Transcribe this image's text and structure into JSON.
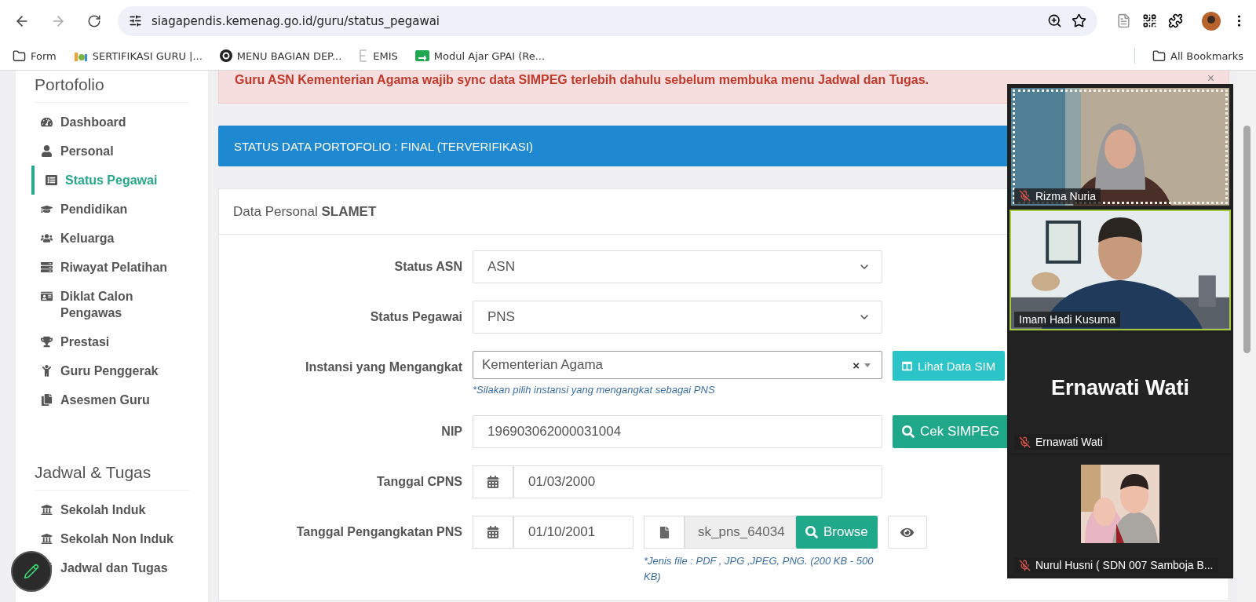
{
  "browser": {
    "url": "siagapendis.kemenag.go.id/guru/status_pegawai",
    "bookmarks": [
      {
        "label": "Form",
        "kind": "folder"
      },
      {
        "label": "SERTIFIKASI GURU |...",
        "kind": "iog"
      },
      {
        "label": "MENU BAGIAN DEP...",
        "kind": "circle"
      },
      {
        "label": "EMIS",
        "kind": "emis"
      },
      {
        "label": "Modul Ajar GPAI (Re...",
        "kind": "green"
      }
    ],
    "all_bookmarks": "All Bookmarks"
  },
  "sidebar": {
    "sections": [
      {
        "title": "Portofolio",
        "items": [
          {
            "label": "Dashboard",
            "selected": false
          },
          {
            "label": "Personal",
            "selected": false
          },
          {
            "label": "Status Pegawai",
            "selected": true
          },
          {
            "label": "Pendidikan",
            "selected": false
          },
          {
            "label": "Keluarga",
            "selected": false
          },
          {
            "label": "Riwayat Pelatihan",
            "selected": false
          },
          {
            "label": "Diklat Calon Pengawas",
            "selected": false
          },
          {
            "label": "Prestasi",
            "selected": false
          },
          {
            "label": "Guru Penggerak",
            "selected": false
          },
          {
            "label": "Asesmen Guru",
            "selected": false
          }
        ]
      },
      {
        "title": "Jadwal & Tugas",
        "items": [
          {
            "label": "Sekolah Induk",
            "selected": false
          },
          {
            "label": "Sekolah Non Induk",
            "selected": false
          },
          {
            "label": "Jadwal dan Tugas",
            "selected": false
          }
        ]
      }
    ]
  },
  "alert": "Guru ASN Kementerian Agama wajib sync data SIMPEG terlebih dahulu sebelum membuka menu Jadwal dan Tugas.",
  "alert_close": "×",
  "status_banner": "STATUS DATA PORTOFOLIO : FINAL (TERVERIFIKASI)",
  "card": {
    "title": "Data Personal **SLAMET**",
    "fields": [
      {
        "kind": "select",
        "label": "Status ASN",
        "value": "ASN"
      },
      {
        "kind": "select",
        "label": "Status Pegawai",
        "value": "PNS"
      },
      {
        "kind": "combo",
        "label": "Instansi yang Mengangkat",
        "value": "Kementerian Agama",
        "clear": "×",
        "hint": "*Silakan pilih instansi yang mengangkat sebagai PNS",
        "button": "Lihat Data SIM"
      },
      {
        "kind": "text",
        "label": "NIP",
        "value": "196903062000031004",
        "button": "Cek SIMPEG"
      },
      {
        "kind": "date",
        "label": "Tanggal CPNS",
        "value": "01/03/2000"
      },
      {
        "kind": "date_file",
        "label": "Tanggal Pengangkatan PNS",
        "value": "01/10/2001",
        "file": "sk_pns_64034",
        "button": "Browse",
        "hint": "*Jenis file : PDF , JPG ,JPEG, PNG. (200 KB - 500 KB)"
      }
    ]
  },
  "meeting": {
    "participants": [
      {
        "kind": "video",
        "name": "Rizma Nuria",
        "muted": true,
        "speaking": false,
        "framed": true
      },
      {
        "kind": "video",
        "name": "Imam Hadi Kusuma",
        "muted": false,
        "speaking": true,
        "framed": false
      },
      {
        "kind": "name_only",
        "display_name": "Ernawati Wati",
        "name": "Ernawati Wati",
        "muted": true,
        "speaking": false,
        "framed": false
      },
      {
        "name": "Nurul Husni ( SDN 007 Samboja B...",
        "muted": true,
        "speaking": false,
        "framed": false
      }
    ]
  }
}
